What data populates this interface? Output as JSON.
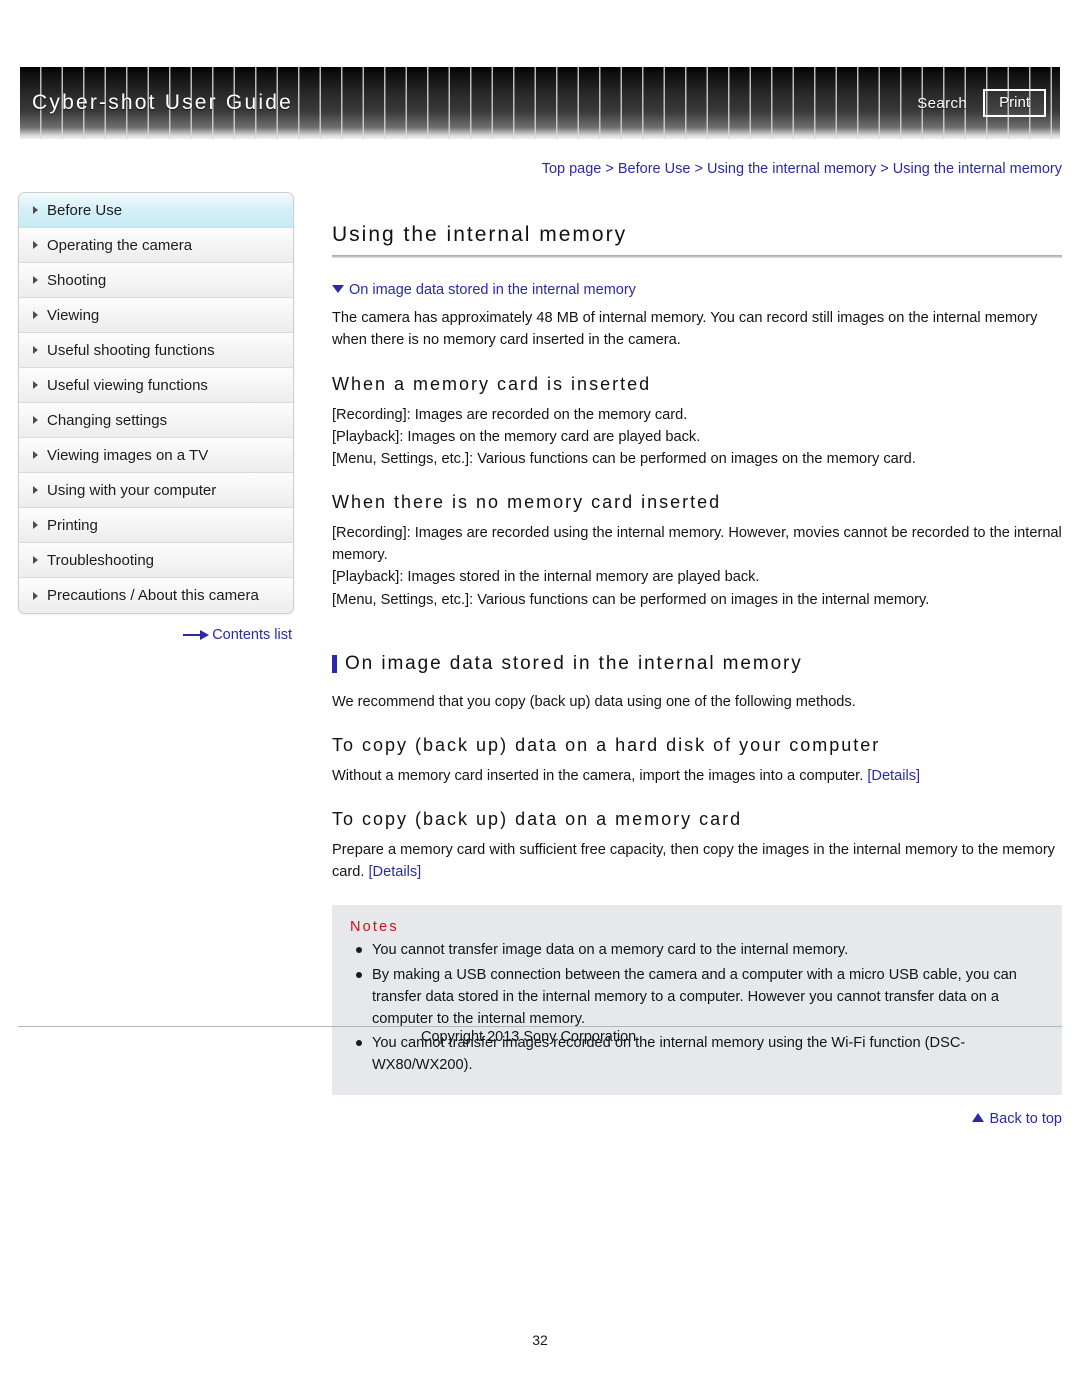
{
  "header": {
    "title": "Cyber-shot User Guide",
    "search_label": "Search",
    "print_label": "Print"
  },
  "breadcrumb": {
    "items": [
      "Top page",
      "Before Use",
      "Using the internal memory",
      "Using the internal memory"
    ],
    "separator": " > "
  },
  "sidebar": {
    "items": [
      {
        "label": "Before Use",
        "active": true
      },
      {
        "label": "Operating the camera",
        "active": false
      },
      {
        "label": "Shooting",
        "active": false
      },
      {
        "label": "Viewing",
        "active": false
      },
      {
        "label": "Useful shooting functions",
        "active": false
      },
      {
        "label": "Useful viewing functions",
        "active": false
      },
      {
        "label": "Changing settings",
        "active": false
      },
      {
        "label": "Viewing images on a TV",
        "active": false
      },
      {
        "label": "Using with your computer",
        "active": false
      },
      {
        "label": "Printing",
        "active": false
      },
      {
        "label": "Troubleshooting",
        "active": false
      },
      {
        "label": "Precautions / About this camera",
        "active": false
      }
    ],
    "contents_list_label": "Contents list"
  },
  "main": {
    "page_title": "Using the internal memory",
    "anchor_link": "On image data stored in the internal memory",
    "intro_paragraph": "The camera has approximately 48 MB of internal memory. You can record still images on the internal memory when there is no memory card inserted in the camera.",
    "sub1_title": "When a memory card is inserted",
    "sub1_lines": [
      "[Recording]: Images are recorded on the memory card.",
      "[Playback]: Images on the memory card are played back.",
      "[Menu, Settings, etc.]: Various functions can be performed on images on the memory card."
    ],
    "sub2_title": "When there is no memory card inserted",
    "sub2_lines": [
      "[Recording]: Images are recorded using the internal memory. However, movies cannot be recorded to the internal memory.",
      "[Playback]: Images stored in the internal memory are played back.",
      "[Menu, Settings, etc.]: Various functions can be performed on images in the internal memory."
    ],
    "section_title": "On image data stored in the internal memory",
    "section_paragraph": "We recommend that you copy (back up) data using one of the following methods.",
    "sub3_title": "To copy (back up) data on a hard disk of your computer",
    "sub3_text": "Without a memory card inserted in the camera, import the images into a computer. ",
    "sub3_link": "[Details]",
    "sub4_title": "To copy (back up) data on a memory card",
    "sub4_text": "Prepare a memory card with sufficient free capacity, then copy the images in the internal memory to the memory card. ",
    "sub4_link": "[Details]",
    "notes": {
      "title": "Notes",
      "items": [
        "You cannot transfer image data on a memory card to the internal memory.",
        "By making a USB connection between the camera and a computer with a micro USB cable, you can transfer data stored in the internal memory to a computer. However you cannot transfer data on a computer to the internal memory.",
        "You cannot transfer images recorded on the internal memory using the Wi-Fi function (DSC-WX80/WX200)."
      ]
    },
    "back_to_top": "Back to top"
  },
  "footer": {
    "copyright": "Copyright 2013 Sony Corporation",
    "page_number": "32"
  },
  "colors": {
    "link": "#2a2aa8",
    "notes_title": "#d01010",
    "active_nav": "#c7ebf5",
    "notes_bg": "#e7e8ec"
  }
}
